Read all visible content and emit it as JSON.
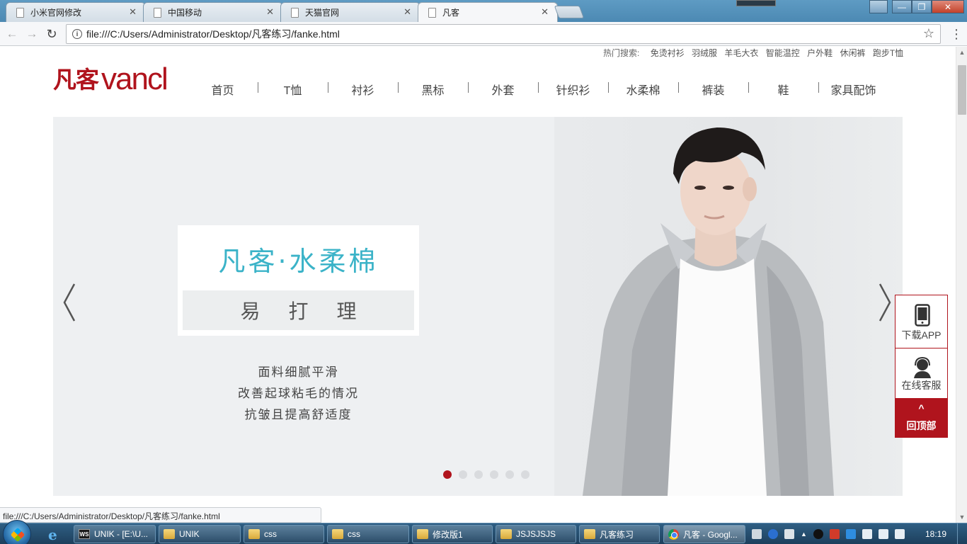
{
  "browser": {
    "tabs": [
      {
        "title": "小米官网修改",
        "active": false
      },
      {
        "title": "中国移动",
        "active": false
      },
      {
        "title": "天猫官网",
        "active": false
      },
      {
        "title": "凡客",
        "active": true
      }
    ],
    "url": "file:///C:/Users/Administrator/Desktop/凡客练习/fanke.html",
    "status_url": "file:///C:/Users/Administrator/Desktop/凡客练习/fanke.html"
  },
  "site": {
    "hot_search": {
      "label": "热门搜索:",
      "terms": [
        "免烫衬衫",
        "羽绒服",
        "羊毛大衣",
        "智能温控",
        "户外鞋",
        "休闲裤",
        "跑步T恤"
      ]
    },
    "logo": {
      "cn": "凡客",
      "en": "vancl"
    },
    "nav": [
      "首页",
      "T恤",
      "衬衫",
      "黑标",
      "外套",
      "针织衫",
      "水柔棉",
      "裤装",
      "鞋",
      "家具配饰"
    ],
    "banner": {
      "title": "凡客·水柔棉",
      "subtitle": "易打理",
      "lines": [
        "面料细腻平滑",
        "改善起球粘毛的情况",
        "抗皱且提高舒适度"
      ],
      "slide_count": 6,
      "active_slide": 1
    },
    "side_widget": {
      "download": "下载APP",
      "service": "在线客服",
      "top_caret": "^",
      "top": "回顶部"
    },
    "colors": {
      "brand": "#b0141d",
      "accent": "#3bb3c8"
    }
  },
  "taskbar": {
    "items": [
      {
        "label": "UNIK - [E:\\U...",
        "icon": "ws-icon"
      },
      {
        "label": "UNIK",
        "icon": "folder-icon"
      },
      {
        "label": "css",
        "icon": "folder-icon"
      },
      {
        "label": "css",
        "icon": "folder-icon"
      },
      {
        "label": "修改版1",
        "icon": "folder-icon"
      },
      {
        "label": "JSJSJSJS",
        "icon": "folder-icon"
      },
      {
        "label": "凡客练习",
        "icon": "folder-icon"
      },
      {
        "label": "凡客 - Googl...",
        "icon": "chrome-icon"
      }
    ],
    "time": "18:19"
  }
}
